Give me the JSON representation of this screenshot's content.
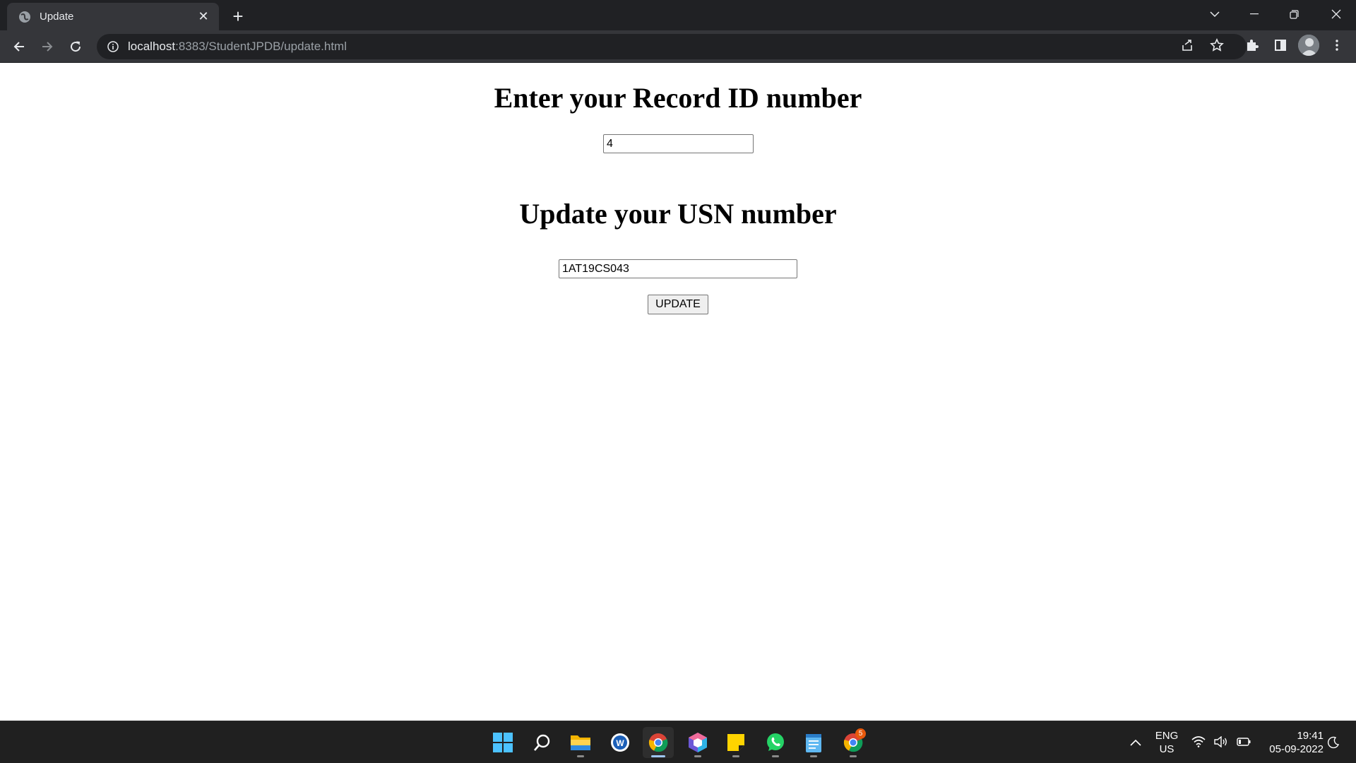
{
  "browser": {
    "tab_title": "Update",
    "url_host": "localhost",
    "url_rest": ":8383/StudentJPDB/update.html"
  },
  "page": {
    "record_heading": "Enter your Record ID number",
    "record_value": "4",
    "usn_heading": "Update your USN number",
    "usn_value": "1AT19CS043",
    "update_label": "UPDATE"
  },
  "taskbar": {
    "apps": [
      "start-icon",
      "search-icon",
      "file-explorer-icon",
      "word-icon",
      "chrome-icon",
      "box-app-icon",
      "sticky-notes-icon",
      "whatsapp-icon",
      "notepad-icon",
      "chrome-icon"
    ],
    "chrome_badge": "5",
    "lang_line1": "ENG",
    "lang_line2": "US",
    "time": "19:41",
    "date": "05-09-2022"
  }
}
